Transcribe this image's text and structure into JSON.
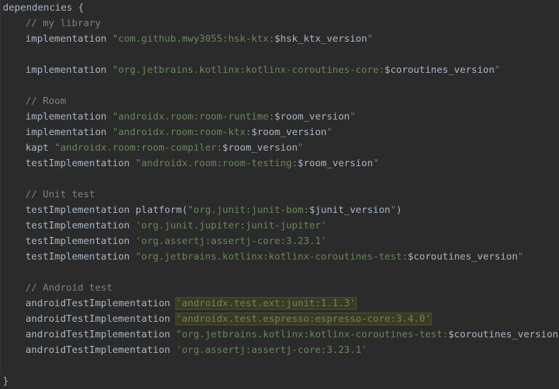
{
  "editor": {
    "lines": [
      [
        {
          "c": "plain",
          "t": "dependencies {"
        }
      ],
      [
        {
          "c": "comment",
          "t": "// my library"
        }
      ],
      [
        {
          "c": "plain",
          "t": "implementation "
        },
        {
          "c": "str",
          "t": "\"com.github.mwy3055:hsk-ktx:"
        },
        {
          "c": "var",
          "t": "$hsk_ktx_version"
        },
        {
          "c": "str",
          "t": "\""
        }
      ],
      [],
      [
        {
          "c": "plain",
          "t": "implementation "
        },
        {
          "c": "str",
          "t": "\"org.jetbrains.kotlinx:kotlinx-coroutines-core:"
        },
        {
          "c": "var",
          "t": "$coroutines_version"
        },
        {
          "c": "str",
          "t": "\""
        }
      ],
      [],
      [
        {
          "c": "comment",
          "t": "// Room"
        }
      ],
      [
        {
          "c": "plain",
          "t": "implementation "
        },
        {
          "c": "str",
          "t": "\"androidx.room:room-runtime:"
        },
        {
          "c": "var",
          "t": "$room_version"
        },
        {
          "c": "str",
          "t": "\""
        }
      ],
      [
        {
          "c": "plain",
          "t": "implementation "
        },
        {
          "c": "str",
          "t": "\"androidx.room:room-ktx:"
        },
        {
          "c": "var",
          "t": "$room_version"
        },
        {
          "c": "str",
          "t": "\""
        }
      ],
      [
        {
          "c": "plain",
          "t": "kapt "
        },
        {
          "c": "str",
          "t": "\"androidx.room:room-compiler:"
        },
        {
          "c": "var",
          "t": "$room_version"
        },
        {
          "c": "str",
          "t": "\""
        }
      ],
      [
        {
          "c": "plain",
          "t": "testImplementation "
        },
        {
          "c": "str",
          "t": "\"androidx.room:room-testing:"
        },
        {
          "c": "var",
          "t": "$room_version"
        },
        {
          "c": "str",
          "t": "\""
        }
      ],
      [],
      [
        {
          "c": "comment",
          "t": "// Unit test"
        }
      ],
      [
        {
          "c": "plain",
          "t": "testImplementation platform("
        },
        {
          "c": "str",
          "t": "\"org.junit:junit-bom:"
        },
        {
          "c": "var",
          "t": "$junit_version"
        },
        {
          "c": "str",
          "t": "\""
        },
        {
          "c": "plain",
          "t": ")"
        }
      ],
      [
        {
          "c": "plain",
          "t": "testImplementation "
        },
        {
          "c": "str",
          "t": "'org.junit.jupiter:junit-jupiter'"
        }
      ],
      [
        {
          "c": "plain",
          "t": "testImplementation "
        },
        {
          "c": "str",
          "t": "'org.assertj:assertj-core:3.23.1'"
        }
      ],
      [
        {
          "c": "plain",
          "t": "testImplementation "
        },
        {
          "c": "str",
          "t": "\"org.jetbrains.kotlinx:kotlinx-coroutines-test:"
        },
        {
          "c": "var",
          "t": "$coroutines_version"
        },
        {
          "c": "str",
          "t": "\""
        }
      ],
      [],
      [
        {
          "c": "comment",
          "t": "// Android test"
        }
      ],
      [
        {
          "c": "plain",
          "t": "androidTestImplementation "
        },
        {
          "c": "str hl",
          "t": "'androidx.test.ext:junit:1.1.3'"
        }
      ],
      [
        {
          "c": "plain",
          "t": "androidTestImplementation "
        },
        {
          "c": "str hl",
          "t": "'androidx.test.espresso:espresso-core:3.4.0'"
        }
      ],
      [
        {
          "c": "plain",
          "t": "androidTestImplementation "
        },
        {
          "c": "str",
          "t": "\"org.jetbrains.kotlinx:kotlinx-coroutines-test:"
        },
        {
          "c": "var",
          "t": "$coroutines_version"
        },
        {
          "c": "str",
          "t": "\""
        }
      ],
      [
        {
          "c": "plain",
          "t": "androidTestImplementation "
        },
        {
          "c": "str",
          "t": "'org.assertj:assertj-core:3.23.1'"
        }
      ],
      [],
      [
        {
          "c": "plain",
          "t": "}"
        }
      ]
    ]
  },
  "colors": {
    "background": "#2b2b2b",
    "plain_text": "#a9b7c6",
    "comment": "#808080",
    "string": "#6a8759",
    "highlight_bg": "#3b3b23"
  }
}
